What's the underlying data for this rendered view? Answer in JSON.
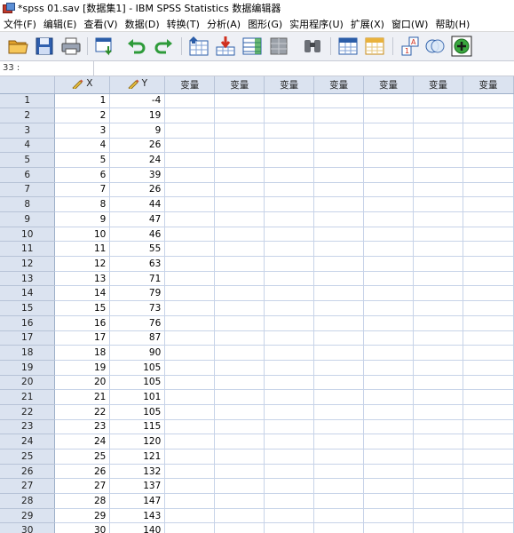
{
  "window": {
    "title": "*spss 01.sav [数据集1] - IBM SPSS Statistics 数据编辑器"
  },
  "menu": [
    "文件(F)",
    "编辑(E)",
    "查看(V)",
    "数据(D)",
    "转换(T)",
    "分析(A)",
    "图形(G)",
    "实用程序(U)",
    "扩展(X)",
    "窗口(W)",
    "帮助(H)"
  ],
  "toolbar": {
    "icons": [
      "open-folder-icon",
      "save-icon",
      "print-icon",
      "recall-dialog-icon",
      "undo-icon",
      "redo-icon",
      "goto-case-icon",
      "goto-variable-icon",
      "variables-icon",
      "split-file-icon",
      "find-icon",
      "insert-cases-icon",
      "insert-variable-icon",
      "value-labels-icon",
      "use-sets-icon",
      "add-icon"
    ]
  },
  "cell_editor": {
    "ref": "33 :",
    "value": ""
  },
  "grid": {
    "columns": [
      {
        "name": "X",
        "measure_icon": "pencil-icon"
      },
      {
        "name": "Y",
        "measure_icon": "pencil-icon"
      },
      {
        "name": "变量"
      },
      {
        "name": "变量"
      },
      {
        "name": "变量"
      },
      {
        "name": "变量"
      },
      {
        "name": "变量"
      },
      {
        "name": "变量"
      },
      {
        "name": "变量"
      }
    ],
    "rows": [
      {
        "n": "1",
        "x": "1",
        "y": "-4"
      },
      {
        "n": "2",
        "x": "2",
        "y": "19"
      },
      {
        "n": "3",
        "x": "3",
        "y": "9"
      },
      {
        "n": "4",
        "x": "4",
        "y": "26"
      },
      {
        "n": "5",
        "x": "5",
        "y": "24"
      },
      {
        "n": "6",
        "x": "6",
        "y": "39"
      },
      {
        "n": "7",
        "x": "7",
        "y": "26"
      },
      {
        "n": "8",
        "x": "8",
        "y": "44"
      },
      {
        "n": "9",
        "x": "9",
        "y": "47"
      },
      {
        "n": "10",
        "x": "10",
        "y": "46"
      },
      {
        "n": "11",
        "x": "11",
        "y": "55"
      },
      {
        "n": "12",
        "x": "12",
        "y": "63"
      },
      {
        "n": "13",
        "x": "13",
        "y": "71"
      },
      {
        "n": "14",
        "x": "14",
        "y": "79"
      },
      {
        "n": "15",
        "x": "15",
        "y": "73"
      },
      {
        "n": "16",
        "x": "16",
        "y": "76"
      },
      {
        "n": "17",
        "x": "17",
        "y": "87"
      },
      {
        "n": "18",
        "x": "18",
        "y": "90"
      },
      {
        "n": "19",
        "x": "19",
        "y": "105"
      },
      {
        "n": "20",
        "x": "20",
        "y": "105"
      },
      {
        "n": "21",
        "x": "21",
        "y": "101"
      },
      {
        "n": "22",
        "x": "22",
        "y": "105"
      },
      {
        "n": "23",
        "x": "23",
        "y": "115"
      },
      {
        "n": "24",
        "x": "24",
        "y": "120"
      },
      {
        "n": "25",
        "x": "25",
        "y": "121"
      },
      {
        "n": "26",
        "x": "26",
        "y": "132"
      },
      {
        "n": "27",
        "x": "27",
        "y": "137"
      },
      {
        "n": "28",
        "x": "28",
        "y": "147"
      },
      {
        "n": "29",
        "x": "29",
        "y": "143"
      },
      {
        "n": "30",
        "x": "30",
        "y": "140"
      }
    ]
  },
  "colors": {
    "header_bg": "#dbe3f0",
    "grid_line": "#c7d3e8",
    "toolbar_bg": "#eef0f5"
  }
}
